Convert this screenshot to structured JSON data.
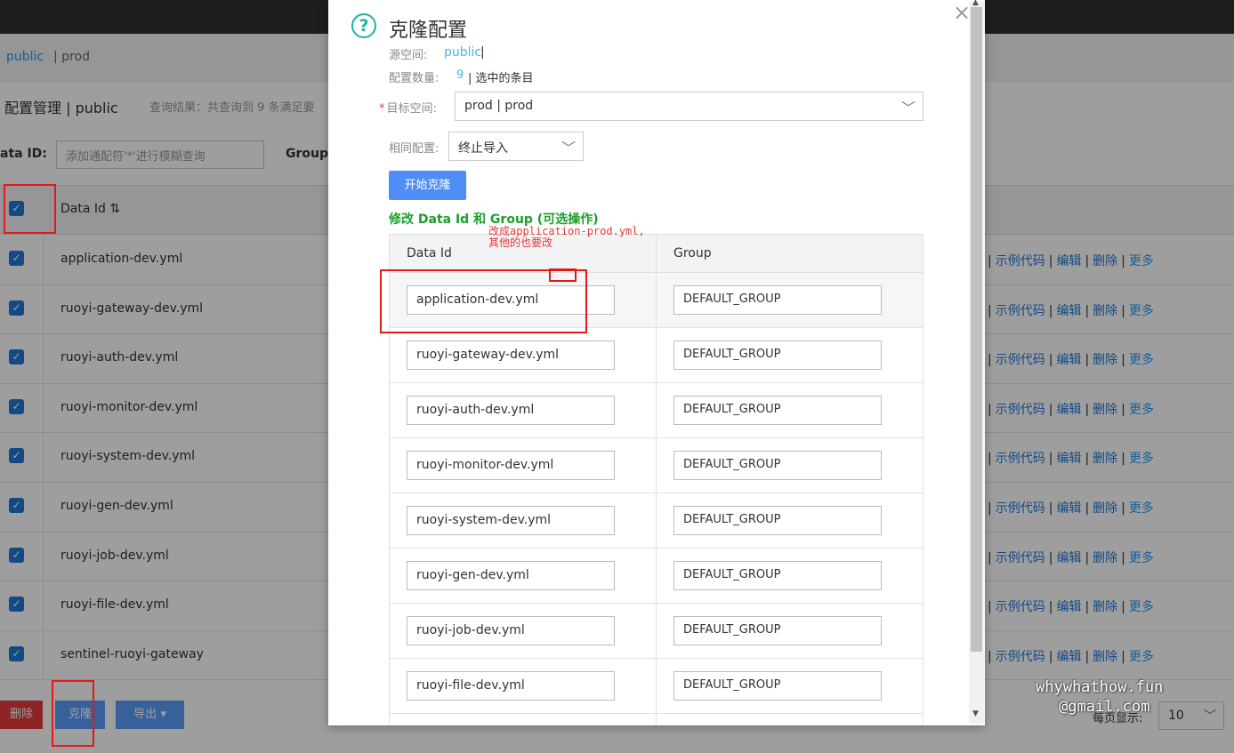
{
  "background": {
    "namespaces": {
      "active": "public",
      "other": "| prod"
    },
    "page_title": "配置管理 | public",
    "query_result": "查询结果：共查询到 9 条满足要",
    "filters": {
      "dataid_label": "ata ID:",
      "dataid_placeholder": "添加通配符'*'进行模糊查询",
      "group_label": "Group:"
    },
    "table": {
      "header_dataid": "Data Id",
      "sort_icon": "⇅",
      "rows": [
        "application-dev.yml",
        "ruoyi-gateway-dev.yml",
        "ruoyi-auth-dev.yml",
        "ruoyi-monitor-dev.yml",
        "ruoyi-system-dev.yml",
        "ruoyi-gen-dev.yml",
        "ruoyi-job-dev.yml",
        "ruoyi-file-dev.yml",
        "sentinel-ruoyi-gateway"
      ],
      "actions": {
        "sample": "示例代码",
        "edit": "编辑",
        "delete": "删除",
        "more": "更多"
      }
    },
    "buttons": {
      "delete": "删除",
      "clone": "克隆",
      "export": "导出"
    },
    "page_size_label": "每页显示:",
    "page_size_value": "10"
  },
  "modal": {
    "title": "克隆配置",
    "source_label": "源空间:",
    "source_value": "public",
    "source_bar": "|",
    "count_label": "配置数量:",
    "count_value": "9",
    "count_suffix": "| 选中的条目",
    "target_label": "目标空间:",
    "target_value": "prod | prod",
    "policy_label": "相同配置:",
    "policy_value": "终止导入",
    "start_button": "开始克隆",
    "edit_hint": "修改 Data Id 和 Group (可选操作)",
    "table": {
      "col_dataid": "Data Id",
      "col_group": "Group",
      "rows": [
        {
          "data_id": "application-dev.yml",
          "group": "DEFAULT_GROUP"
        },
        {
          "data_id": "ruoyi-gateway-dev.yml",
          "group": "DEFAULT_GROUP"
        },
        {
          "data_id": "ruoyi-auth-dev.yml",
          "group": "DEFAULT_GROUP"
        },
        {
          "data_id": "ruoyi-monitor-dev.yml",
          "group": "DEFAULT_GROUP"
        },
        {
          "data_id": "ruoyi-system-dev.yml",
          "group": "DEFAULT_GROUP"
        },
        {
          "data_id": "ruoyi-gen-dev.yml",
          "group": "DEFAULT_GROUP"
        },
        {
          "data_id": "ruoyi-job-dev.yml",
          "group": "DEFAULT_GROUP"
        },
        {
          "data_id": "ruoyi-file-dev.yml",
          "group": "DEFAULT_GROUP"
        }
      ]
    }
  },
  "annotation": {
    "line1": "改成application-prod.yml,",
    "line2": "其他的也要改"
  },
  "watermark": {
    "line1": "whywhathow.fun",
    "line2": "@gmail.com"
  },
  "colors": {
    "primary": "#1f77d5",
    "danger": "#e4393c",
    "hint": "#1aa02b",
    "accent": "#47b8e0"
  }
}
